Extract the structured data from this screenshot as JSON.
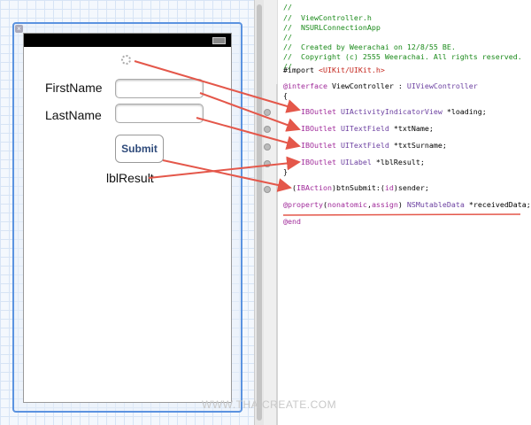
{
  "form": {
    "firstname_label": "FirstName",
    "lastname_label": "LastName",
    "submit_label": "Submit",
    "result_label": "lblResult",
    "firstname_value": "",
    "lastname_value": ""
  },
  "code": {
    "lines": [
      [
        {
          "c": "c",
          "t": "//"
        }
      ],
      [
        {
          "c": "c",
          "t": "//  ViewController.h"
        }
      ],
      [
        {
          "c": "c",
          "t": "//  NSURLConnectionApp"
        }
      ],
      [
        {
          "c": "c",
          "t": "//"
        }
      ],
      [
        {
          "c": "c",
          "t": "//  Created by Weerachai on 12/8/55 BE."
        }
      ],
      [
        {
          "c": "c",
          "t": "//  Copyright (c) 2555 Weerachai. All rights reserved."
        }
      ],
      [
        {
          "c": "c",
          "t": "//"
        }
      ],
      [
        {
          "c": "",
          "t": "#import "
        },
        {
          "c": "s",
          "t": "<UIKit/UIKit.h>"
        }
      ],
      [
        {
          "c": "k",
          "t": "@interface"
        },
        {
          "c": "",
          "t": " ViewController : "
        },
        {
          "c": "t",
          "t": "UIViewController"
        }
      ],
      [
        {
          "c": "",
          "t": "{"
        }
      ],
      [
        {
          "c": "k",
          "t": "    IBOutlet "
        },
        {
          "c": "t",
          "t": "UIActivityIndicatorView"
        },
        {
          "c": "",
          "t": " *loading;"
        }
      ],
      [
        {
          "c": "k",
          "t": "    IBOutlet "
        },
        {
          "c": "t",
          "t": "UITextField"
        },
        {
          "c": "",
          "t": " *txtName;"
        }
      ],
      [
        {
          "c": "k",
          "t": "    IBOutlet "
        },
        {
          "c": "t",
          "t": "UITextField"
        },
        {
          "c": "",
          "t": " *txtSurname;"
        }
      ],
      [
        {
          "c": "k",
          "t": "    IBOutlet "
        },
        {
          "c": "t",
          "t": "UILabel"
        },
        {
          "c": "",
          "t": " *lblResult;"
        }
      ],
      [
        {
          "c": "",
          "t": "}"
        }
      ],
      [
        {
          "c": "",
          "t": "- ("
        },
        {
          "c": "k",
          "t": "IBAction"
        },
        {
          "c": "",
          "t": ")btnSubmit:("
        },
        {
          "c": "k",
          "t": "id"
        },
        {
          "c": "",
          "t": ")sender;"
        }
      ],
      [
        {
          "c": "k",
          "t": "@property"
        },
        {
          "c": "",
          "t": "("
        },
        {
          "c": "k",
          "t": "nonatomic"
        },
        {
          "c": "",
          "t": ","
        },
        {
          "c": "k",
          "t": "assign"
        },
        {
          "c": "",
          "t": ") "
        },
        {
          "c": "t",
          "t": "NSMutableData"
        },
        {
          "c": "",
          "t": " *receivedData;"
        }
      ],
      [
        {
          "c": "k",
          "t": "@end"
        }
      ]
    ]
  },
  "watermark": "WWW.THAICREATE.COM",
  "colors": {
    "arrow": "#e4574a",
    "selection": "#5b93e0"
  }
}
